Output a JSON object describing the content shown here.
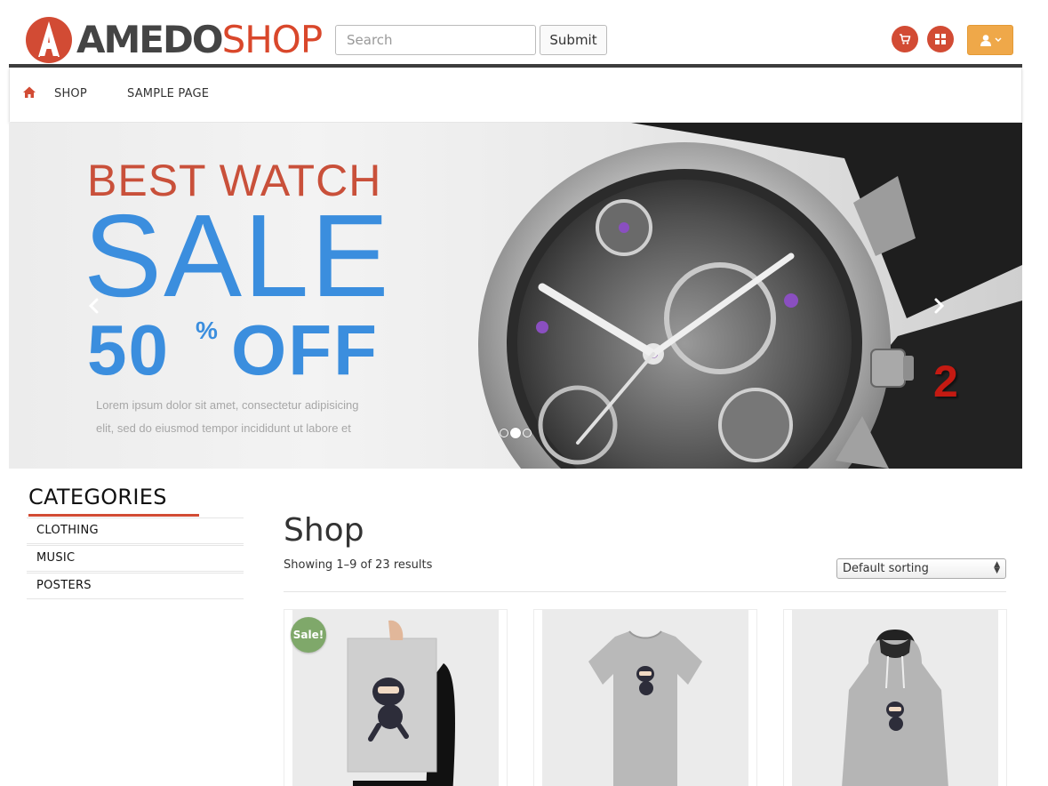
{
  "header": {
    "logo_part1": "AMEDO",
    "logo_part2": "SHOP",
    "search_placeholder": "Search",
    "submit_label": "Submit",
    "cart_icon": "cart-icon",
    "grid_icon": "grid-icon",
    "user_icon": "user-icon",
    "accent_color": "#d24b34",
    "user_button_color": "#efa849"
  },
  "nav": {
    "home_icon": "home-icon",
    "items": [
      {
        "label": "SHOP"
      },
      {
        "label": "SAMPLE PAGE"
      }
    ]
  },
  "slider": {
    "headline": "BEST WATCH",
    "sale": "SALE",
    "discount_number": "50",
    "discount_percent": "%",
    "discount_off": "OFF",
    "lorem_line1": "Lorem ipsum dolor sit amet, consectetur adipisicing",
    "lorem_line2": "elit, sed do eiusmod tempor incididunt ut labore et",
    "slide_number": "2",
    "dots_count": 3,
    "active_dot": 2
  },
  "sidebar": {
    "title": "CATEGORIES",
    "categories": [
      {
        "label": "CLOTHING"
      },
      {
        "label": "MUSIC"
      },
      {
        "label": "POSTERS"
      }
    ]
  },
  "main": {
    "title": "Shop",
    "results": "Showing 1–9 of 23 results",
    "sorting": "Default sorting",
    "products": [
      {
        "kind": "poster",
        "badge": "Sale!"
      },
      {
        "kind": "t-shirt",
        "badge": ""
      },
      {
        "kind": "hoodie",
        "badge": ""
      }
    ]
  }
}
